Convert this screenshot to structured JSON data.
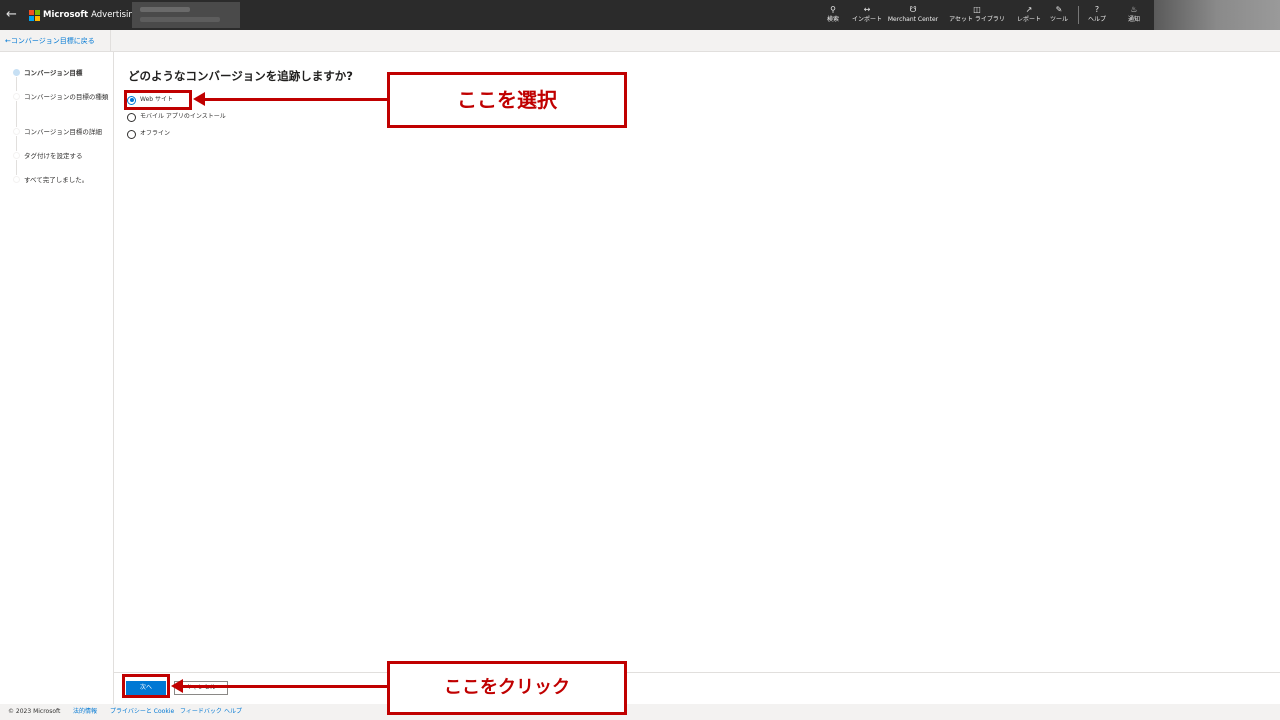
{
  "header": {
    "brand_name": "Microsoft",
    "product_name": "Advertising",
    "tools": [
      {
        "label": "検索",
        "icon": "search-icon"
      },
      {
        "label": "インポート",
        "icon": "import-icon"
      },
      {
        "label": "Merchant Center",
        "icon": "cart-icon"
      },
      {
        "label": "アセット ライブラリ",
        "icon": "asset-library-icon"
      },
      {
        "label": "レポート",
        "icon": "report-icon"
      },
      {
        "label": "ツール",
        "icon": "wrench-icon"
      },
      {
        "label": "ヘルプ",
        "icon": "help-icon"
      },
      {
        "label": "通知",
        "icon": "bell-icon"
      }
    ],
    "logo_colors": [
      "#f25022",
      "#7fba00",
      "#00a4ef",
      "#ffb900"
    ]
  },
  "subbar": {
    "back_link": "コンバージョン目標に戻る"
  },
  "stepper": {
    "steps": [
      {
        "label": "コンバージョン目標",
        "active": true
      },
      {
        "label": "コンバージョンの目標の種類",
        "active": false
      },
      {
        "label": "コンバージョン目標の詳細",
        "active": false
      },
      {
        "label": "タグ付けを設定する",
        "active": false
      },
      {
        "label": "すべて完了しました。",
        "active": false
      }
    ]
  },
  "main": {
    "question": "どのようなコンバージョンを追跡しますか?",
    "options": [
      {
        "label": "Web サイト",
        "selected": true
      },
      {
        "label": "モバイル アプリのインストール",
        "selected": false
      },
      {
        "label": "オフライン",
        "selected": false
      }
    ]
  },
  "actions": {
    "next_label": "次へ",
    "cancel_label": "キャンセル"
  },
  "footer": {
    "copyright": "© 2023 Microsoft",
    "links": [
      "法的情報",
      "プライバシーと Cookie",
      "フィードバック",
      "ヘルプ"
    ]
  },
  "annotations": {
    "select_callout": "ここを選択",
    "click_callout": "ここをクリック",
    "color": "#c00000"
  }
}
